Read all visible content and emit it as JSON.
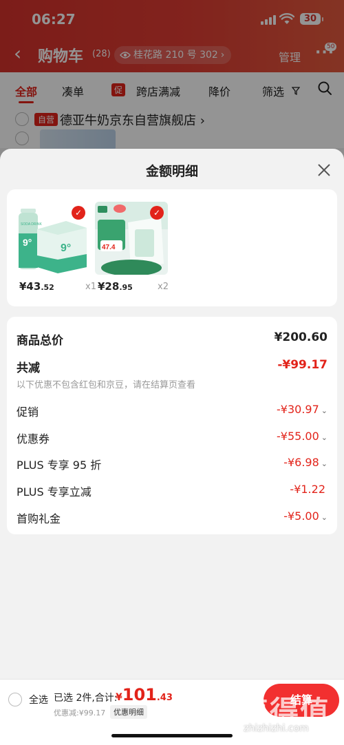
{
  "status": {
    "time": "06:27",
    "battery": "30"
  },
  "nav": {
    "back": "‹",
    "title": "购物车",
    "count": "(28)",
    "address": "桂花路 210 号 302",
    "manage": "管理",
    "more": "···",
    "badge": "50"
  },
  "filters": {
    "all": "全部",
    "combine": "凑单",
    "promo_tag": "促",
    "cross_store": "跨店满减",
    "price_drop": "降价",
    "filter": "筛选"
  },
  "store": {
    "tag": "自营",
    "name": "德亚牛奶京东自营旗舰店 ›"
  },
  "sheet": {
    "title": "金额明细",
    "items": [
      {
        "price_int": "¥43",
        "price_dec": ".52",
        "qty": "x1"
      },
      {
        "price_int": "¥28",
        "price_dec": ".95",
        "qty": "x2"
      }
    ],
    "product_text": {
      "soda_label": "SODA DRINK",
      "nine": "9°",
      "promo_price": "47.4"
    },
    "goods_total_label": "商品总价",
    "goods_total": "¥200.60",
    "reduce_label": "共减",
    "reduce_total": "-¥99.17",
    "note": "以下优惠不包含红包和京豆，请在结算页查看",
    "lines": [
      {
        "label": "促销",
        "value": "-¥30.97",
        "chevron": "⌄"
      },
      {
        "label": "优惠券",
        "value": "-¥55.00",
        "chevron": "⌄"
      },
      {
        "label": "PLUS 专享 95 折",
        "value": "-¥6.98",
        "chevron": "⌄"
      },
      {
        "label": "PLUS 专享立减",
        "value": "-¥1.22",
        "chevron": ""
      },
      {
        "label": "首购礼金",
        "value": "-¥5.00",
        "chevron": "⌄"
      }
    ]
  },
  "bottom": {
    "select_all": "全选",
    "selected": "已选 2件,合计:",
    "currency": "¥",
    "total_int": "101",
    "total_dec": ".43",
    "discount": "优惠减:¥99.17",
    "detail_btn": "优惠明细",
    "checkout": "结算"
  },
  "watermark": {
    "text": "值得值",
    "url": "zhizhizhi.com"
  },
  "colors": {
    "brand_red": "#e2231a",
    "header_red": "#d6322c",
    "teal": "#3db38a"
  }
}
